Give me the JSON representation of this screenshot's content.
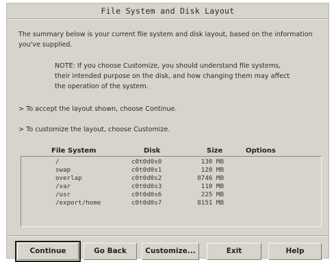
{
  "title": "File System and Disk Layout",
  "intro": "The summary below is your current file system and disk layout, based on the information you've supplied.",
  "note": "NOTE: If you choose Customize, you should understand file systems, their intended purpose on the disk, and how changing them may affect the operation of the system.",
  "accept_hint": "> To accept the layout shown, choose Continue.",
  "customize_hint": "> To customize the layout, choose Customize.",
  "table": {
    "headers": {
      "file_system": "File System",
      "disk": "Disk",
      "size": "Size",
      "options": "Options"
    },
    "rows": [
      {
        "file_system": "/",
        "disk": "c0t0d0s0",
        "size": "130 MB",
        "options": ""
      },
      {
        "file_system": "swap",
        "disk": "c0t0d0s1",
        "size": "128 MB",
        "options": ""
      },
      {
        "file_system": "overlap",
        "disk": "c0t0d0s2",
        "size": "8746 MB",
        "options": ""
      },
      {
        "file_system": "/var",
        "disk": "c0t0d0s3",
        "size": "110 MB",
        "options": ""
      },
      {
        "file_system": "/usr",
        "disk": "c0t0d0s6",
        "size": "225 MB",
        "options": ""
      },
      {
        "file_system": "/export/home",
        "disk": "c0t0d0s7",
        "size": "8151 MB",
        "options": ""
      }
    ]
  },
  "buttons": {
    "continue": "Continue",
    "go_back": "Go Back",
    "customize": "Customize...",
    "exit": "Exit",
    "help": "Help"
  },
  "colors": {
    "panel_background": "#d7d4cc",
    "text": "#2b2b2b"
  }
}
